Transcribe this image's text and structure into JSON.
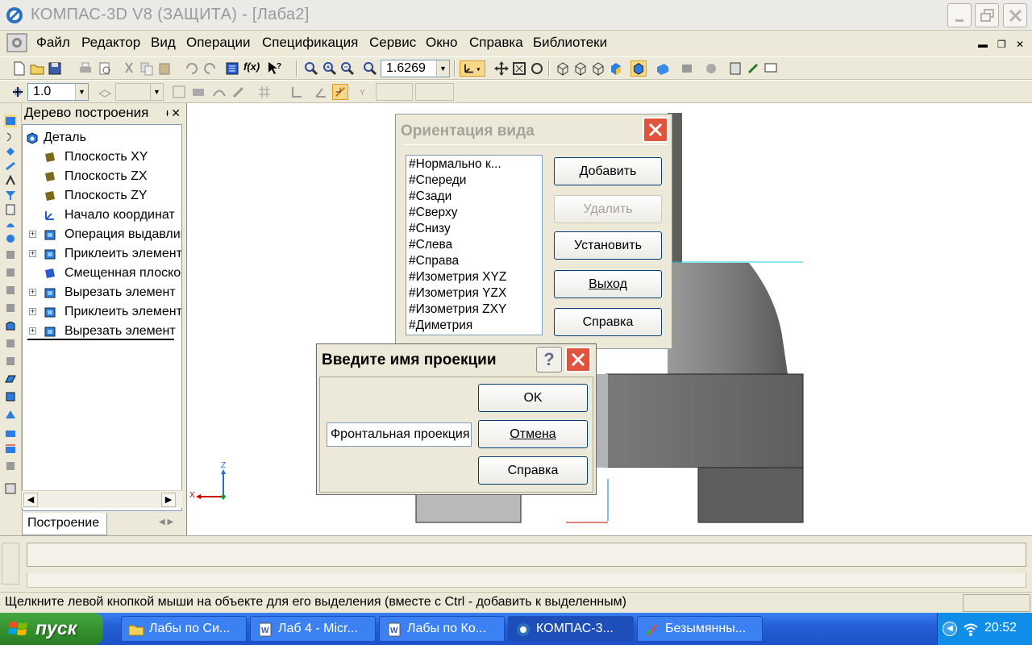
{
  "window": {
    "title": "КОМПАС-3D V8 (ЗАЩИТА) - [Лаба2]"
  },
  "menu": {
    "items": [
      "Файл",
      "Редактор",
      "Вид",
      "Операции",
      "Спецификация",
      "Сервис",
      "Окно",
      "Справка",
      "Библиотеки"
    ]
  },
  "toolbar": {
    "zoom_value": "1.6269",
    "step_value": "1.0"
  },
  "tree": {
    "header": "Дерево построения",
    "pin_glyph": "ᵻ",
    "close_glyph": "✕",
    "root": "Деталь",
    "nodes": [
      {
        "label": "Плоскость XY",
        "expandable": false
      },
      {
        "label": "Плоскость ZX",
        "expandable": false
      },
      {
        "label": "Плоскость ZY",
        "expandable": false
      },
      {
        "label": "Начало координат",
        "expandable": false
      },
      {
        "label": "Операция выдавливания",
        "expandable": true
      },
      {
        "label": "Приклеить элемент",
        "expandable": true
      },
      {
        "label": "Смещенная плоскость",
        "expandable": false
      },
      {
        "label": "Вырезать элемент",
        "expandable": true
      },
      {
        "label": "Приклеить элемент",
        "expandable": true
      },
      {
        "label": "Вырезать элемент",
        "expandable": true
      }
    ],
    "tab_label": "Построение"
  },
  "axes": {
    "z_label": "Z",
    "x_label": "X"
  },
  "orientation_dialog": {
    "title": "Ориентация вида",
    "list": [
      "#Нормально к...",
      "#Спереди",
      "#Сзади",
      "#Сверху",
      "#Снизу",
      "#Слева",
      "#Справа",
      "#Изометрия XYZ",
      "#Изометрия YZX",
      "#Изометрия ZXY",
      "#Диметрия"
    ],
    "buttons": {
      "add": "Добавить",
      "delete": "Удалить",
      "set": "Установить",
      "exit": "Выход",
      "help": "Справка"
    }
  },
  "projection_dialog": {
    "title": "Введите имя проекции",
    "input_value": "Фронтальная проекция",
    "buttons": {
      "ok": "OK",
      "cancel": "Отмена",
      "help": "Справка"
    }
  },
  "status": {
    "message": "Щелкните левой кнопкой мыши на объекте для его выделения (вместе с Ctrl - добавить к выделенным)"
  },
  "taskbar": {
    "start_label": "пуск",
    "buttons": [
      {
        "label": "Лабы по Си...",
        "icon": "folder-icon",
        "active": false
      },
      {
        "label": "Лаб 4 - Micr...",
        "icon": "word-icon",
        "active": false
      },
      {
        "label": "Лабы по Ко...",
        "icon": "word-icon",
        "active": false
      },
      {
        "label": "КОМПАС-3...",
        "icon": "kompas-icon",
        "active": true
      },
      {
        "label": "Безымянны...",
        "icon": "paint-icon",
        "active": false
      }
    ],
    "clock": "20:52"
  },
  "colors": {
    "accent_blue": "#1e4eb8",
    "close_red": "#e0533c",
    "model_gray": "#555555",
    "axis_red": "#d00000",
    "axis_blue": "#1e6fe0"
  }
}
